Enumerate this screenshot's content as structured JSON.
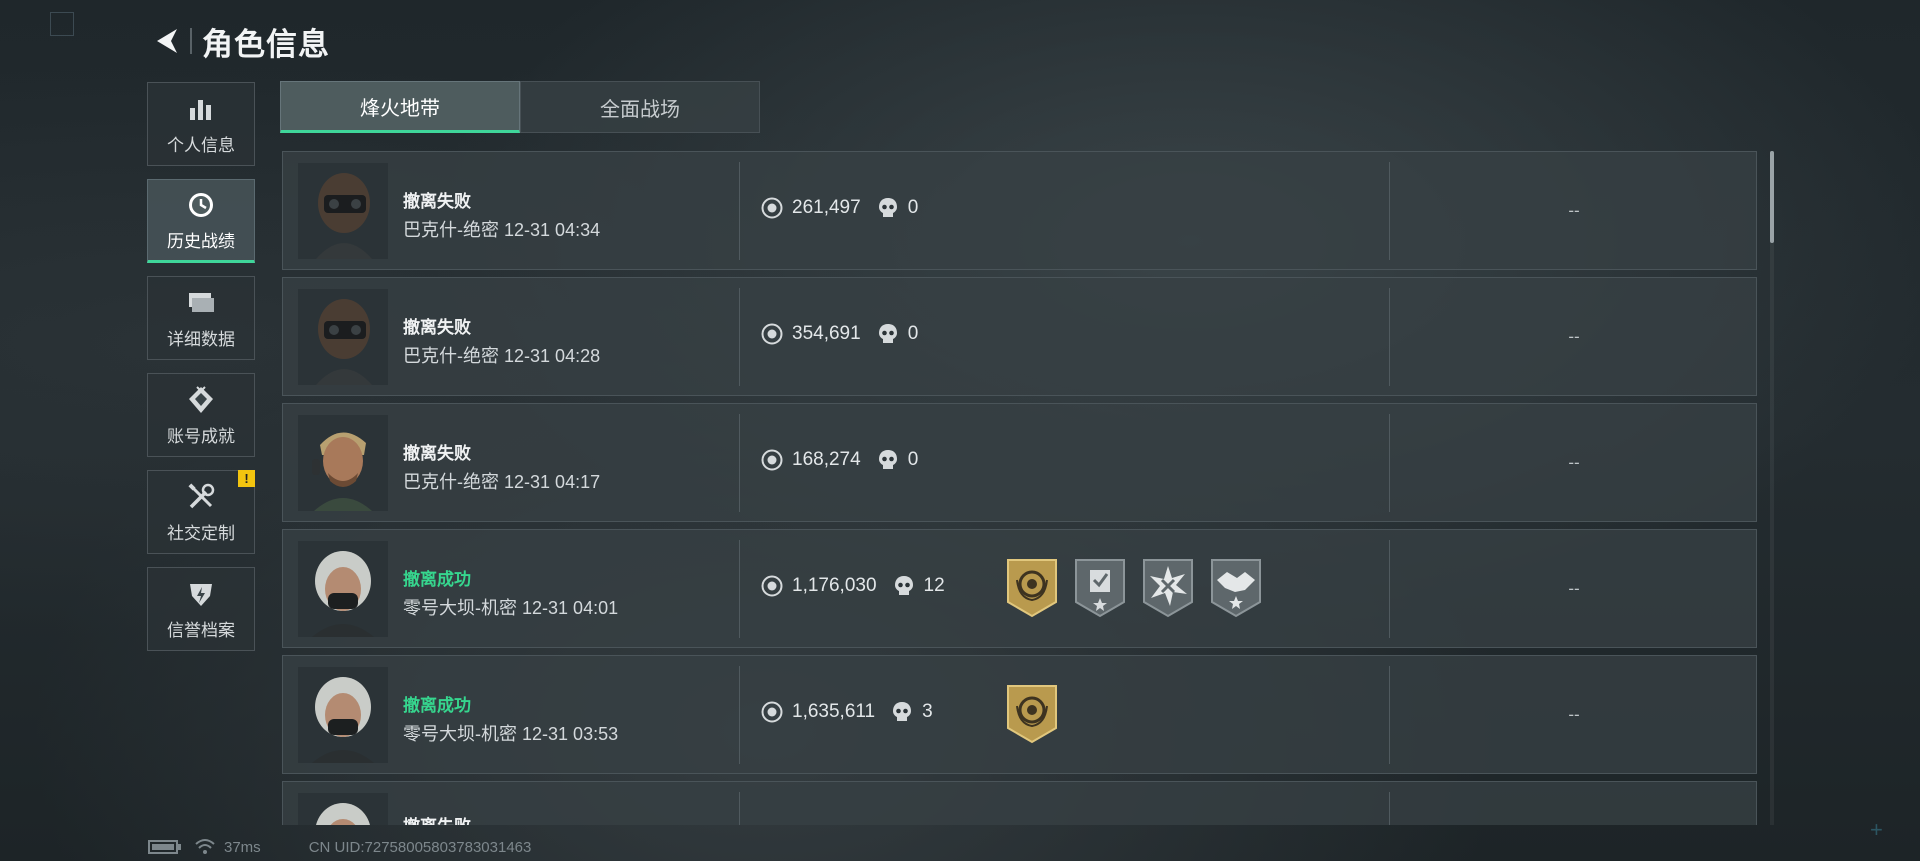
{
  "header": {
    "title": "角色信息"
  },
  "sidebar": {
    "items": [
      {
        "label": "个人信息",
        "icon": "bar-chart-icon",
        "active": false
      },
      {
        "label": "历史战绩",
        "icon": "clock-icon",
        "active": true
      },
      {
        "label": "详细数据",
        "icon": "folder-stack-icon",
        "active": false
      },
      {
        "label": "账号成就",
        "icon": "achievement-icon",
        "active": false
      },
      {
        "label": "社交定制",
        "icon": "tools-icon",
        "active": false,
        "badge": "!"
      },
      {
        "label": "信誉档案",
        "icon": "shield-icon",
        "active": false
      }
    ]
  },
  "tabs": [
    {
      "label": "烽火地带",
      "active": true
    },
    {
      "label": "全面战场",
      "active": false
    }
  ],
  "matches": [
    {
      "result": "撤离失败",
      "success": false,
      "map": "巴克什-绝密",
      "time": "12-31 04:34",
      "value": "261,497",
      "kills": "0",
      "medals": [],
      "extra": "--",
      "avatar": "masked-operator-icon"
    },
    {
      "result": "撤离失败",
      "success": false,
      "map": "巴克什-绝密",
      "time": "12-31 04:28",
      "value": "354,691",
      "kills": "0",
      "medals": [],
      "extra": "--",
      "avatar": "masked-operator-icon"
    },
    {
      "result": "撤离失败",
      "success": false,
      "map": "巴克什-绝密",
      "time": "12-31 04:17",
      "value": "168,274",
      "kills": "0",
      "medals": [],
      "extra": "--",
      "avatar": "blond-operator-icon"
    },
    {
      "result": "撤离成功",
      "success": true,
      "map": "零号大坝-机密",
      "time": "12-31 04:01",
      "value": "1,176,030",
      "kills": "12",
      "medals": [
        "gold-wreath-medal-icon",
        "silver-document-medal-icon",
        "silver-burst-medal-icon",
        "silver-handshake-medal-icon"
      ],
      "extra": "--",
      "avatar": "white-hair-operator-icon"
    },
    {
      "result": "撤离成功",
      "success": true,
      "map": "零号大坝-机密",
      "time": "12-31 03:53",
      "value": "1,635,611",
      "kills": "3",
      "medals": [
        "gold-wreath-medal-icon"
      ],
      "extra": "--",
      "avatar": "white-hair-operator-icon"
    },
    {
      "result": "撤离失败",
      "success": false,
      "map": "",
      "time": "",
      "value": "",
      "kills": "",
      "medals": [],
      "extra": "",
      "avatar": "white-hair-operator-icon"
    }
  ],
  "footer": {
    "ping": "37ms",
    "uid": "CN UID:72758005803783031463"
  },
  "colors": {
    "accent": "#3fd69a",
    "success": "#36d68e",
    "alert": "#f2c40f",
    "gold_medal": "#b99a4e",
    "silver_medal": "#5e676b"
  }
}
